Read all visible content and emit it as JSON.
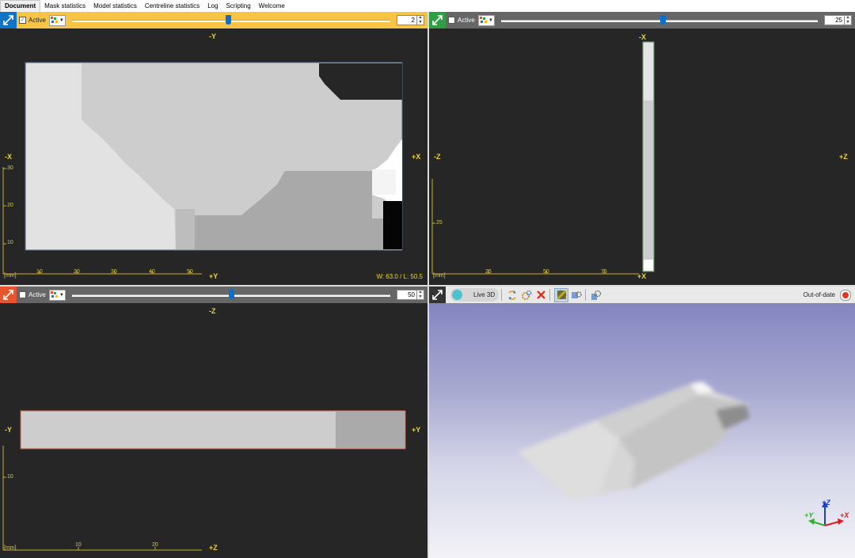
{
  "tabs": [
    {
      "label": "Document",
      "active": true
    },
    {
      "label": "Mask statistics"
    },
    {
      "label": "Model statistics"
    },
    {
      "label": "Centreline statistics"
    },
    {
      "label": "Log"
    },
    {
      "label": "Scripting"
    },
    {
      "label": "Welcome"
    }
  ],
  "views": {
    "top_left": {
      "active_label": "Active",
      "active_checked": true,
      "slice_value": "2",
      "slider_fraction": 0.49,
      "orient": {
        "top": "-Y",
        "left": "-X",
        "right": "+X",
        "bottom": "+Y"
      },
      "ruler_unit": "[mm]",
      "x_ticks": [
        "10",
        "20",
        "30",
        "40",
        "50"
      ],
      "y_ticks": [
        "30",
        "20",
        "10"
      ],
      "wl_text": "W: 63.0 / L: 50.5",
      "accent": "#f7c444"
    },
    "top_right": {
      "active_label": "Active",
      "active_checked": false,
      "slice_value": "25",
      "slider_fraction": 0.51,
      "orient": {
        "top": "-X",
        "left": "-Z",
        "right": "+Z",
        "bottom": "+X"
      },
      "ruler_unit": "[mm]",
      "x_ticks": [
        "25",
        "50",
        "75"
      ],
      "y_ticks": [
        "25"
      ],
      "accent": "#2ea043"
    },
    "bottom_left": {
      "active_label": "Active",
      "active_checked": false,
      "slice_value": "50",
      "slider_fraction": 0.5,
      "orient": {
        "top": "-Z",
        "left": "-Y",
        "right": "+Y",
        "bottom": "+Z"
      },
      "ruler_unit": "[mm]",
      "x_ticks": [
        "10",
        "20"
      ],
      "y_ticks": [
        "10"
      ],
      "accent": "#e8542b"
    },
    "view_3d": {
      "live_label": "Live 3D",
      "status_label": "Out-of-date",
      "axes": {
        "z": "+Z",
        "y": "+Y",
        "x": "+X"
      },
      "colors": {
        "x_axis": "#e01b1b",
        "y_axis": "#2bb32b",
        "z_axis": "#1b3fd0"
      }
    }
  }
}
